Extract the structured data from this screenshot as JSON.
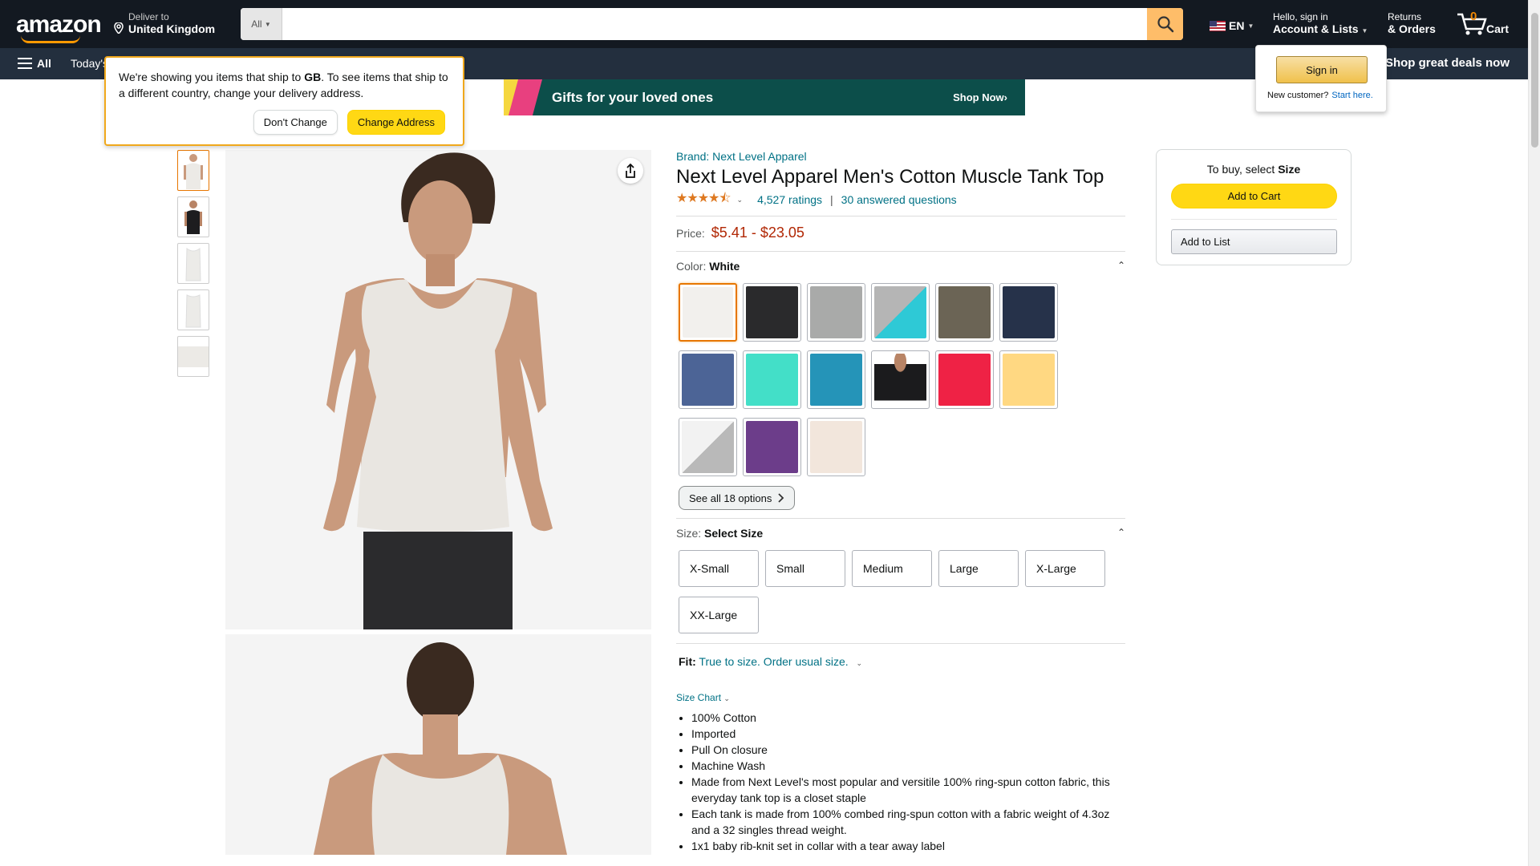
{
  "header": {
    "logo": "amazon",
    "deliver_small": "Deliver to",
    "deliver_big": "United Kingdom",
    "search_category": "All",
    "search_placeholder": "",
    "lang": "EN",
    "account_small": "Hello, sign in",
    "account_big": "Account & Lists",
    "returns_small": "Returns",
    "returns_big": "& Orders",
    "cart_count": "0",
    "cart_label": "Cart"
  },
  "subnav": {
    "all": "All",
    "today": "Today's",
    "deals": "Shop great deals now"
  },
  "popover": {
    "text_before": "We're showing you items that ship to ",
    "country": "GB",
    "text_after": ". To see items that ship to a different country, change your delivery address.",
    "dont_change": "Don't Change",
    "change_address": "Change Address"
  },
  "signin_pop": {
    "button": "Sign in",
    "new_customer": "New customer?",
    "start_here": "Start here."
  },
  "banner": {
    "title": "Gifts for your loved ones",
    "cta": "Shop Now›"
  },
  "product": {
    "brand": "Brand: Next Level Apparel",
    "title": "Next Level Apparel Men's Cotton Muscle Tank Top",
    "stars": "★★★★⯪",
    "rating_count": "4,527 ratings",
    "answered": "30 answered questions",
    "price_label": "Price:",
    "price": "$5.41 - $23.05",
    "color_label": "Color: ",
    "color_value": "White",
    "see_all": "See all 18 options",
    "size_label": "Size: ",
    "size_value": "Select Size",
    "fit_label": "Fit:",
    "fit_text": "True to size. Order usual size.",
    "size_chart": "Size Chart",
    "sizes": [
      "X-Small",
      "Small",
      "Medium",
      "Large",
      "X-Large",
      "XX-Large"
    ],
    "swatch_colors": [
      "#f2f0ed",
      "#2a2a2c",
      "#a9aaa9",
      "#2ec9d6",
      "#6b6455",
      "#26324a",
      "#4c6496",
      "#43dfc8",
      "#2594b8",
      "#1b1b1d",
      "#ef2245",
      "#ffd882",
      "#b9b9b9",
      "#6c3d8a",
      "#f2e6dc"
    ],
    "bullets": [
      "100% Cotton",
      "Imported",
      "Pull On closure",
      "Machine Wash",
      "Made from Next Level's most popular and versitile 100% ring-spun cotton fabric, this everyday tank top is a closet staple",
      "Each tank is made from 100% combed ring-spun cotton with a fabric weight of 4.3oz and a 32 singles thread weight.",
      "1x1 baby rib-knit set in collar with a tear away label"
    ]
  },
  "buybox": {
    "to_buy": "To buy, select ",
    "to_buy_bold": "Size",
    "add_to_cart": "Add to Cart",
    "add_to_list": "Add to List"
  }
}
